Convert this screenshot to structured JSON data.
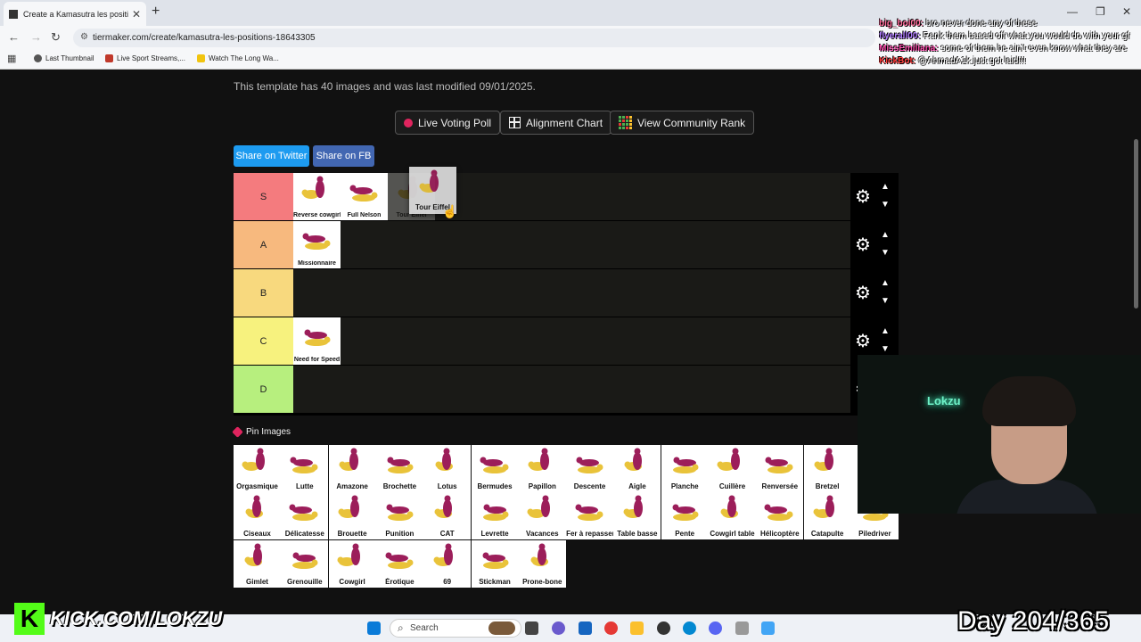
{
  "browser": {
    "tab_title": "Create a Kamasutra les positio",
    "url": "tiermaker.com/create/kamasutra-les-positions-18643305",
    "bookmarks": [
      "Last Thumbnail",
      "Live Sport Streams,...",
      "Watch The Long Wa..."
    ]
  },
  "page": {
    "info_text": "This template has 40 images and was last modified 09/01/2025.",
    "buttons": {
      "live_voting": "Live Voting Poll",
      "alignment": "Alignment Chart",
      "community": "View Community Rank"
    },
    "share": {
      "twitter": "Share on Twitter",
      "fb": "Share on FB"
    },
    "colors": {
      "twitter": "#1d9bf0",
      "fb": "#4267b2"
    }
  },
  "tiers": [
    {
      "label": "S",
      "color": "#f47b7e",
      "items": [
        "Reverse cowgirl",
        "Full Nelson",
        "Tour Eiffel"
      ]
    },
    {
      "label": "A",
      "color": "#f7b97e",
      "items": [
        "Missionnaire"
      ]
    },
    {
      "label": "B",
      "color": "#f8d97e",
      "items": []
    },
    {
      "label": "C",
      "color": "#f7f27e",
      "items": [
        "Need for Speed"
      ]
    },
    {
      "label": "D",
      "color": "#b7ef7e",
      "items": []
    }
  ],
  "dragging": {
    "label": "Tour Eiffel"
  },
  "pin": {
    "title": "Pin Images",
    "items": [
      "Orgasmique",
      "Lutte",
      "Amazone",
      "Brochette",
      "Lotus",
      "Bermudes",
      "Papillon",
      "Descente",
      "Aigle",
      "Planche",
      "Cuillère",
      "Renversée",
      "Bretzel",
      "",
      "Ciseaux",
      "Délicatesse",
      "Brouette",
      "Punition",
      "CAT",
      "Levrette",
      "Vacances",
      "Fer à repasser",
      "Table basse",
      "Pente",
      "Cowgirl table",
      "Hélicoptère",
      "Catapulte",
      "Piledriver",
      "Gimlet",
      "Grenouille",
      "Cowgirl",
      "Érotique",
      "69",
      "Stickman",
      "Prone-bone"
    ]
  },
  "chat": [
    {
      "user": "big_boi00:",
      "text": " bro never done any of these",
      "color": "#ff6b9a"
    },
    {
      "user": "flyerall00:",
      "text": " Rank them based off what you would do with your gf",
      "color": "#b07cff"
    },
    {
      "user": "MissEmiliana:",
      "text": " some of them he ain't even know what they are",
      "color": "#ff4fb0"
    },
    {
      "user": "KickBot:",
      "text": " @AhmadA1k just got laid!!!",
      "color": "#ff3b3b"
    }
  ],
  "webcam_sign": "Lokzu",
  "taskbar": {
    "search": "Search"
  },
  "overlay": {
    "kick": "KICK.COM/LOKZU",
    "day": "Day 204/365"
  }
}
